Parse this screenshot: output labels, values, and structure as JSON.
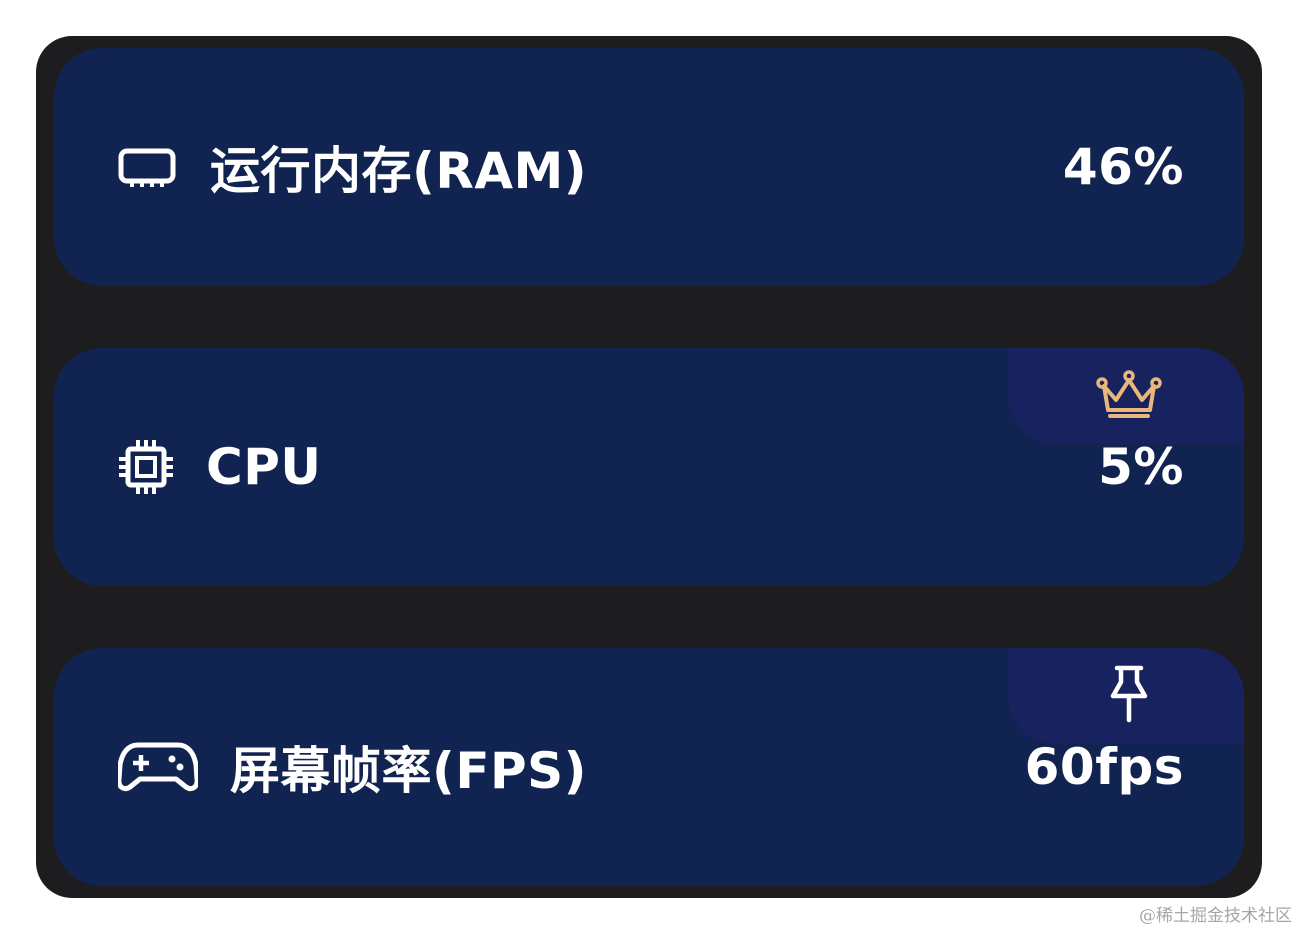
{
  "metrics": [
    {
      "id": "ram",
      "icon": "memory-chip-icon",
      "label": "运行内存(RAM)",
      "value": "46%"
    },
    {
      "id": "cpu",
      "icon": "processor-icon",
      "label": "CPU",
      "value": "5%",
      "badge_icon": "crown-icon"
    },
    {
      "id": "fps",
      "icon": "gamepad-icon",
      "label": "屏幕帧率(FPS)",
      "value": "60fps",
      "badge_icon": "pin-icon"
    }
  ],
  "watermark": "@稀土掘金技术社区",
  "colors": {
    "frame": "#1d1d1f",
    "card": "#112350",
    "badge": "#18225e",
    "crown": "#e9b77c",
    "text": "#ffffff"
  }
}
